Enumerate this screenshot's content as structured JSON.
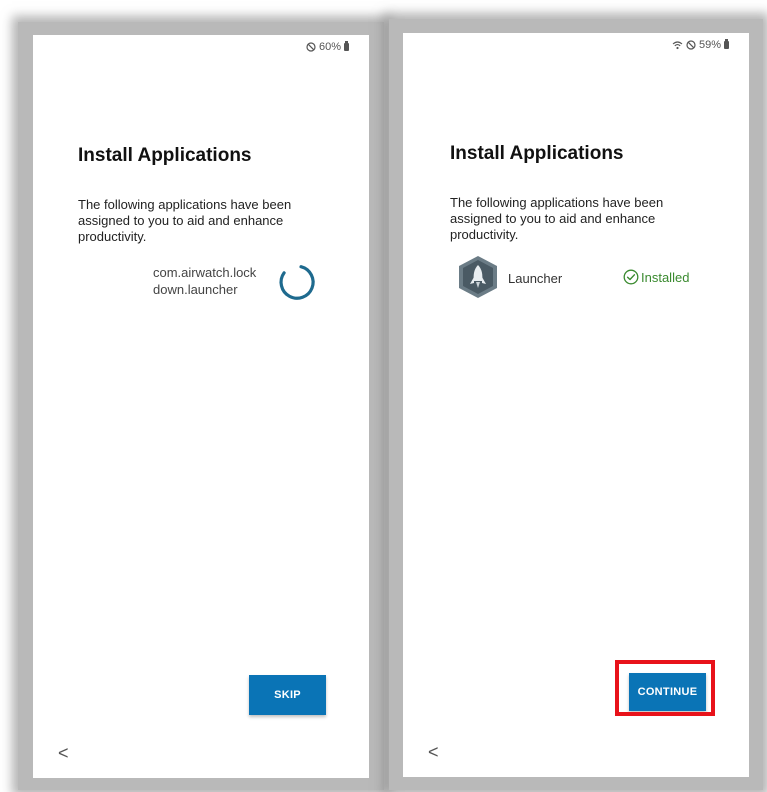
{
  "left_screen": {
    "status": {
      "battery_text": "60%"
    },
    "title": "Install Applications",
    "description": "The following applications have been assigned to you to aid and enhance productivity.",
    "app": {
      "package_name": "com.airwatch.lockdown.launcher",
      "package_line1": "com.airwatch.lock",
      "package_line2": "down.launcher",
      "state_icon": "progress-spinner-icon"
    },
    "skip_label": "SKIP",
    "back_icon": "chevron-left-icon",
    "back_glyph": "<"
  },
  "right_screen": {
    "status": {
      "battery_text": "59%"
    },
    "title": "Install Applications",
    "description": "The following applications have been assigned to you to aid and enhance productivity.",
    "app": {
      "name": "Launcher",
      "icon": "launcher-rocket-icon",
      "status_text": "Installed",
      "status_icon": "check-circle-icon",
      "status_color": "#3a8a2f"
    },
    "continue_label": "CONTINUE",
    "back_icon": "chevron-left-icon",
    "back_glyph": "<"
  },
  "colors": {
    "primary_button": "#0a74b6",
    "highlight_box": "#e8121a"
  }
}
